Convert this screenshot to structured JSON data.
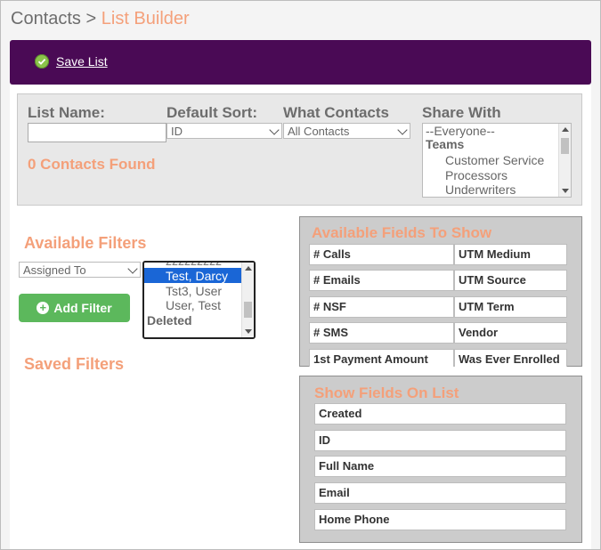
{
  "header": {
    "crumb": "Contacts",
    "separator": ">",
    "current": "List Builder"
  },
  "toolbar": {
    "save_label": "Save List"
  },
  "form": {
    "list_name_label": "List Name:",
    "list_name_value": "",
    "default_sort_label": "Default Sort:",
    "default_sort_value": "ID",
    "what_contacts_label": "What Contacts",
    "what_contacts_value": "All Contacts",
    "share_with_label": "Share With",
    "share_with_options": [
      "--Everyone--",
      "Teams",
      "Customer Service",
      "Processors",
      "Underwriters"
    ],
    "contacts_found": "0 Contacts Found"
  },
  "filters": {
    "available_title": "Available Filters",
    "filter_select_value": "Assigned To",
    "filter_values": [
      "zzzzzzzzz",
      "Test, Darcy",
      "Tst3, User",
      "User, Test",
      "Deleted"
    ],
    "add_filter_label": "Add Filter",
    "saved_title": "Saved Filters"
  },
  "available_fields": {
    "title": "Available Fields To Show",
    "rows": [
      [
        "# Calls",
        "UTM Medium"
      ],
      [
        "# Emails",
        "UTM Source"
      ],
      [
        "# NSF",
        "UTM Term"
      ],
      [
        "# SMS",
        "Vendor"
      ],
      [
        "1st Payment Amount",
        "Was Ever Enrolled"
      ]
    ]
  },
  "show_fields": {
    "title": "Show Fields On List",
    "items": [
      "Created",
      "ID",
      "Full Name",
      "Email",
      "Home Phone"
    ]
  },
  "colors": {
    "accent": "#f4a07a",
    "brand": "#4a0a55",
    "success": "#5cb85c",
    "selected": "#1a66d6"
  }
}
